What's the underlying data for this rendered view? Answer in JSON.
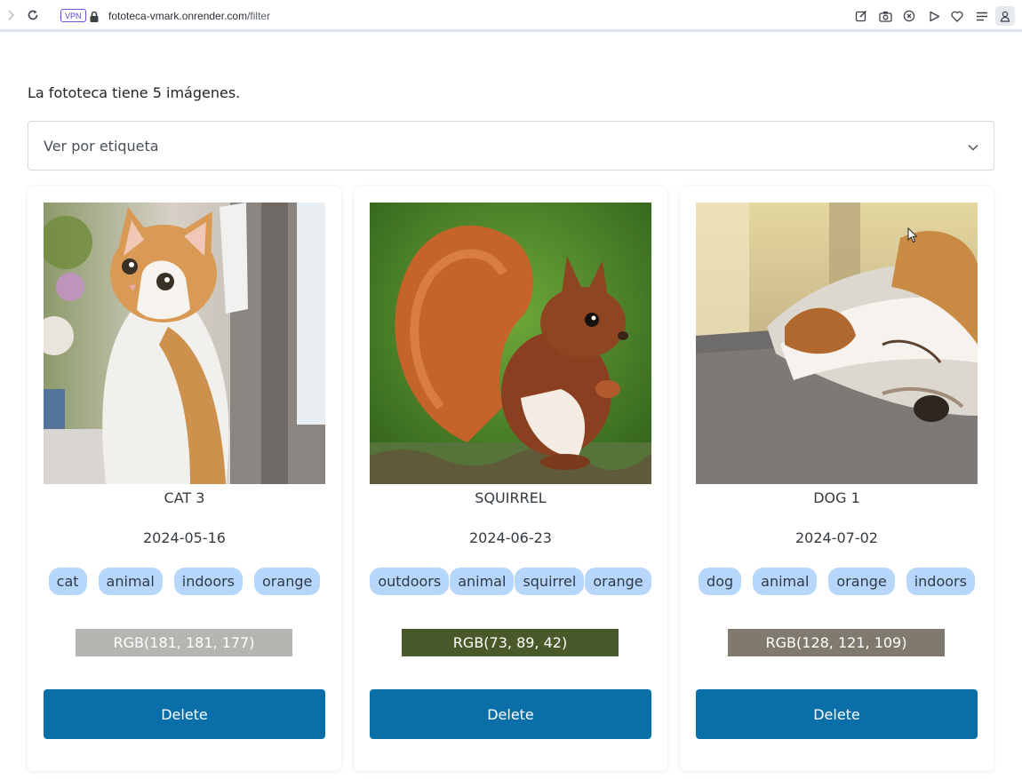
{
  "browser": {
    "vpn_label": "VPN",
    "url_host": "fototeca-vmark.onrender.com",
    "url_path": "/filter"
  },
  "page": {
    "summary": "La fototeca tiene 5 imágenes.",
    "filter_placeholder": "Ver por etiqueta"
  },
  "cards": [
    {
      "title": "CAT 3",
      "date": "2024-05-16",
      "tags": [
        "cat",
        "animal",
        "indoors",
        "orange"
      ],
      "color_label": "RGB(181, 181, 177)",
      "color": "#b5b5b1",
      "delete_label": "Delete"
    },
    {
      "title": "SQUIRREL",
      "date": "2024-06-23",
      "tags": [
        "outdoors",
        "animal",
        "squirrel",
        "orange"
      ],
      "color_label": "RGB(73, 89, 42)",
      "color": "#49592a",
      "delete_label": "Delete"
    },
    {
      "title": "DOG 1",
      "date": "2024-07-02",
      "tags": [
        "dog",
        "animal",
        "orange",
        "indoors"
      ],
      "color_label": "RGB(128, 121, 109)",
      "color": "#80796d",
      "delete_label": "Delete"
    }
  ],
  "colors": {
    "accent_button": "#0a6ea8",
    "tag_background": "#b6d6fb"
  }
}
